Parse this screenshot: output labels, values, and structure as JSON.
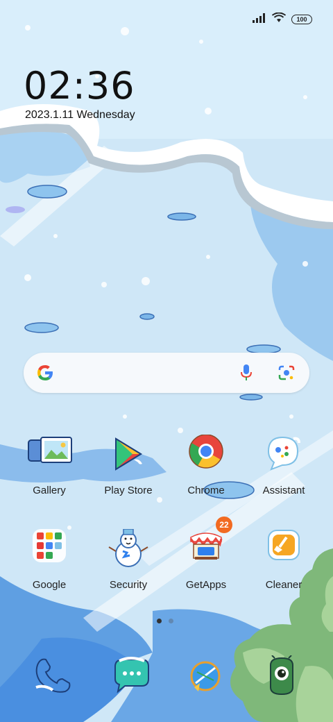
{
  "status_bar": {
    "battery": "100",
    "signal_icon": "signal-icon",
    "wifi_icon": "wifi-icon"
  },
  "clock": {
    "time": "02:36",
    "date": "2023.1.11 Wednesday"
  },
  "search_widget": {
    "logo": "google-logo-icon",
    "mic_icon": "mic-icon",
    "lens_icon": "lens-icon"
  },
  "home_row1": [
    {
      "label": "Gallery",
      "icon": "gallery-icon"
    },
    {
      "label": "Play Store",
      "icon": "play-store-icon"
    },
    {
      "label": "Chrome",
      "icon": "chrome-icon"
    },
    {
      "label": "Assistant",
      "icon": "assistant-icon"
    }
  ],
  "home_row2": [
    {
      "label": "Google",
      "icon": "google-folder-icon"
    },
    {
      "label": "Security",
      "icon": "snowman-security-icon"
    },
    {
      "label": "GetApps",
      "icon": "getapps-icon",
      "badge": "22"
    },
    {
      "label": "Cleaner",
      "icon": "cleaner-icon"
    }
  ],
  "page_indicator": {
    "pages": 2,
    "current": 1
  },
  "dock": [
    {
      "icon": "phone-icon"
    },
    {
      "icon": "messages-icon"
    },
    {
      "icon": "browser-icon"
    },
    {
      "icon": "camera-icon"
    }
  ],
  "colors": {
    "sky": "#cfe7f7",
    "snow": "#ffffff",
    "ice_blue": "#4a8fe0",
    "badge": "#f26a21",
    "tree_green": "#7fb87a"
  }
}
